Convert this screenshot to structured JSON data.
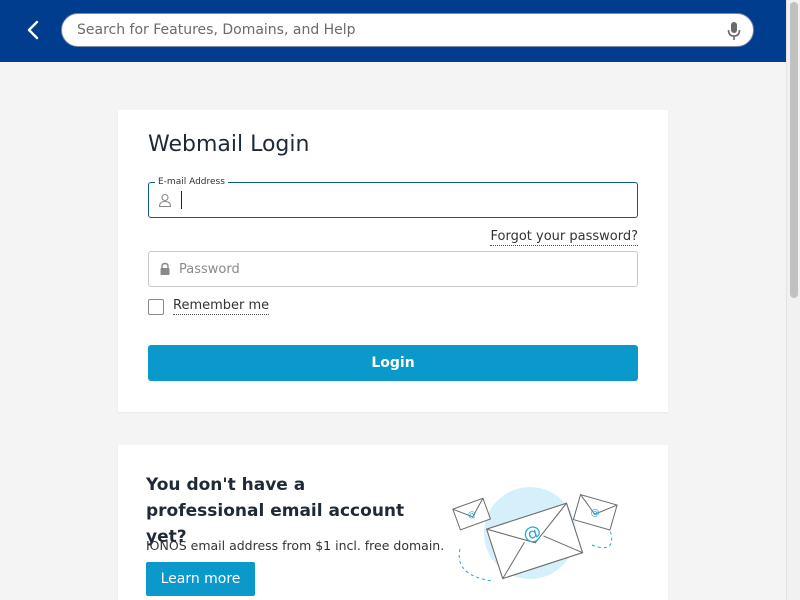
{
  "header": {
    "back_icon": "chevron-left-icon",
    "search_placeholder": "Search for Features, Domains, and Help",
    "search_value": "",
    "mic_icon": "microphone-icon",
    "bg_color": "#003d8f"
  },
  "login": {
    "title": "Webmail Login",
    "email_label": "E-mail Address",
    "email_value": "",
    "email_icon": "user-icon",
    "forgot_label": "Forgot your password?",
    "password_placeholder": "Password",
    "password_value": "",
    "password_icon": "lock-icon",
    "remember_label": "Remember me",
    "remember_checked": false,
    "login_button": "Login",
    "button_color": "#0b99cc"
  },
  "promo": {
    "title": "You don't have a professional email account yet?",
    "text": "IONOS email address from $1 incl. free domain.",
    "button": "Learn more",
    "illustration": "email-envelopes-illustration"
  }
}
